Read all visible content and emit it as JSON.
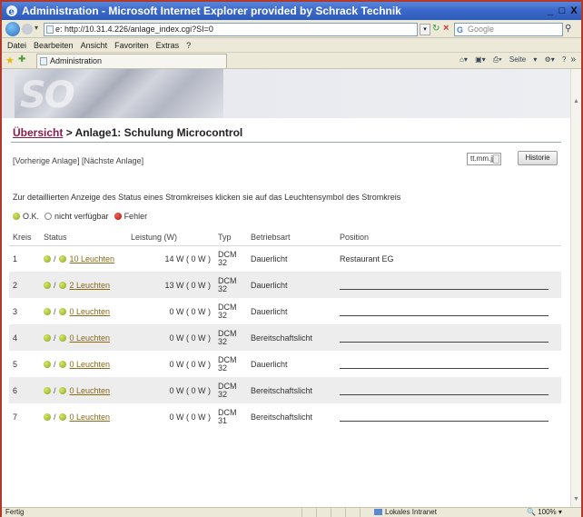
{
  "window": {
    "title": "Administration - Microsoft Internet Explorer provided by Schrack Technik",
    "controls": [
      "_",
      "□",
      "X"
    ]
  },
  "address": {
    "url": "e: http://10.31.4.226/anlage_index.cgi?SI=0",
    "search_placeholder": "Google"
  },
  "menu": [
    "Datei",
    "Bearbeiten",
    "Ansicht",
    "Favoriten",
    "Extras",
    "?"
  ],
  "tab": {
    "label": "Administration"
  },
  "command_bar": {
    "page_label": "Seite",
    "overflow": "»"
  },
  "page": {
    "breadcrumb_link": "Übersicht",
    "breadcrumb_rest": " > Anlage1: Schulung Microcontrol",
    "nav_links": "[Vorherige Anlage] [Nächste Anlage]",
    "date_value": "tt.mm.jj",
    "historie_label": "Historie",
    "info_text": "Zur detaillierten Anzeige des Status eines Stromkreises klicken sie auf das Leuchtensymbol des Stromkreis",
    "legend": {
      "ok": "O.K.",
      "na": "nicht verfügbar",
      "err": "Fehler"
    },
    "table": {
      "headers": [
        "Kreis",
        "Status",
        "Leistung (W)",
        "Typ",
        "Betriebsart",
        "Position"
      ],
      "rows": [
        {
          "kreis": "1",
          "leuchten": "10 Leuchten",
          "leistung": "14 W ( 0 W )",
          "typ1": "DCM",
          "typ2": "32",
          "betriebsart": "Dauerlicht",
          "position": "Restaurant EG"
        },
        {
          "kreis": "2",
          "leuchten": "2 Leuchten",
          "leistung": "13 W ( 0 W )",
          "typ1": "DCM",
          "typ2": "32",
          "betriebsart": "Dauerlicht",
          "position": ""
        },
        {
          "kreis": "3",
          "leuchten": "0 Leuchten",
          "leistung": "0 W ( 0 W )",
          "typ1": "DCM",
          "typ2": "32",
          "betriebsart": "Dauerlicht",
          "position": ""
        },
        {
          "kreis": "4",
          "leuchten": "0 Leuchten",
          "leistung": "0 W ( 0 W )",
          "typ1": "DCM",
          "typ2": "32",
          "betriebsart": "Bereitschaftslicht",
          "position": ""
        },
        {
          "kreis": "5",
          "leuchten": "0 Leuchten",
          "leistung": "0 W ( 0 W )",
          "typ1": "DCM",
          "typ2": "32",
          "betriebsart": "Dauerlicht",
          "position": ""
        },
        {
          "kreis": "6",
          "leuchten": "0 Leuchten",
          "leistung": "0 W ( 0 W )",
          "typ1": "DCM",
          "typ2": "32",
          "betriebsart": "Bereitschaftslicht",
          "position": ""
        },
        {
          "kreis": "7",
          "leuchten": "0 Leuchten",
          "leistung": "0 W ( 0 W )",
          "typ1": "DCM",
          "typ2": "31",
          "betriebsart": "Bereitschaftslicht",
          "position": ""
        }
      ]
    }
  },
  "statusbar": {
    "left": "Fertig",
    "zone": "Lokales Intranet",
    "zoom": "100%"
  },
  "colors": {
    "title_bar": "#3d6ccc",
    "breadcrumb_link": "#8b1a4a",
    "status_ok": "#8aa61a",
    "status_error": "#b3160c"
  }
}
